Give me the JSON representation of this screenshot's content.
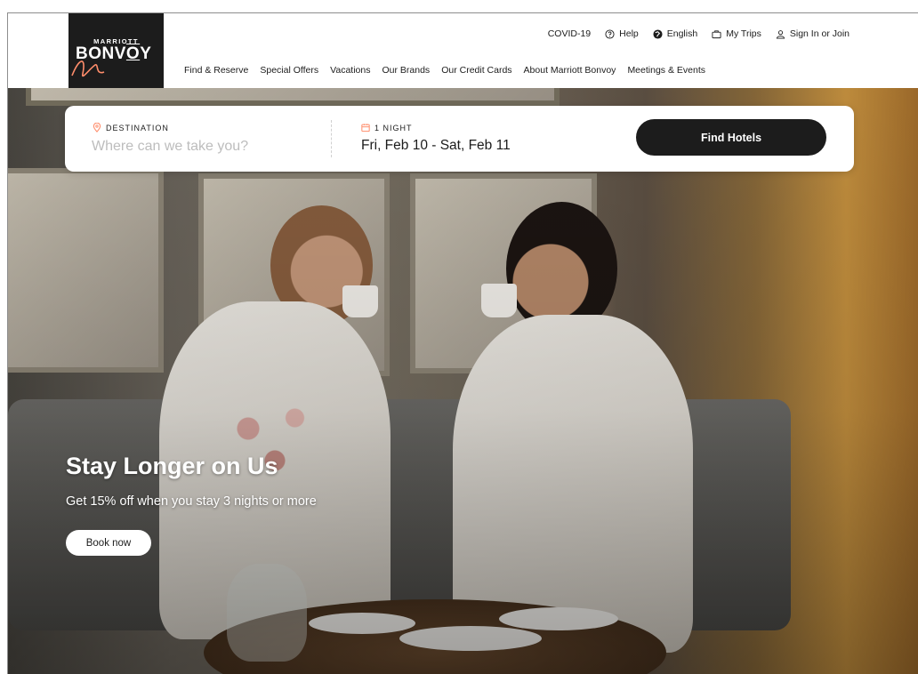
{
  "logo": {
    "top": "MARRIOTT",
    "main": "BONVƷY",
    "alt_main": "BONVOY"
  },
  "util_nav": [
    {
      "label": "COVID-19",
      "icon": "none"
    },
    {
      "label": "Help",
      "icon": "help-circle-icon"
    },
    {
      "label": "English",
      "icon": "globe-icon"
    },
    {
      "label": "My Trips",
      "icon": "suitcase-icon"
    },
    {
      "label": "Sign In or Join",
      "icon": "user-icon"
    }
  ],
  "main_nav": [
    "Find & Reserve",
    "Special Offers",
    "Vacations",
    "Our Brands",
    "Our Credit Cards",
    "About Marriott Bonvoy",
    "Meetings & Events"
  ],
  "search": {
    "destination_label": "DESTINATION",
    "destination_placeholder": "Where can we take you?",
    "nights_label": "1 NIGHT",
    "dates": "Fri, Feb 10 - Sat, Feb 11",
    "find_button": "Find Hotels"
  },
  "promo": {
    "title": "Stay Longer on Us",
    "subtitle": "Get 15% off when you stay 3 nights or more",
    "cta": "Book now"
  },
  "colors": {
    "accent": "#ff8d6b",
    "dark": "#1c1c1c",
    "white": "#ffffff"
  }
}
